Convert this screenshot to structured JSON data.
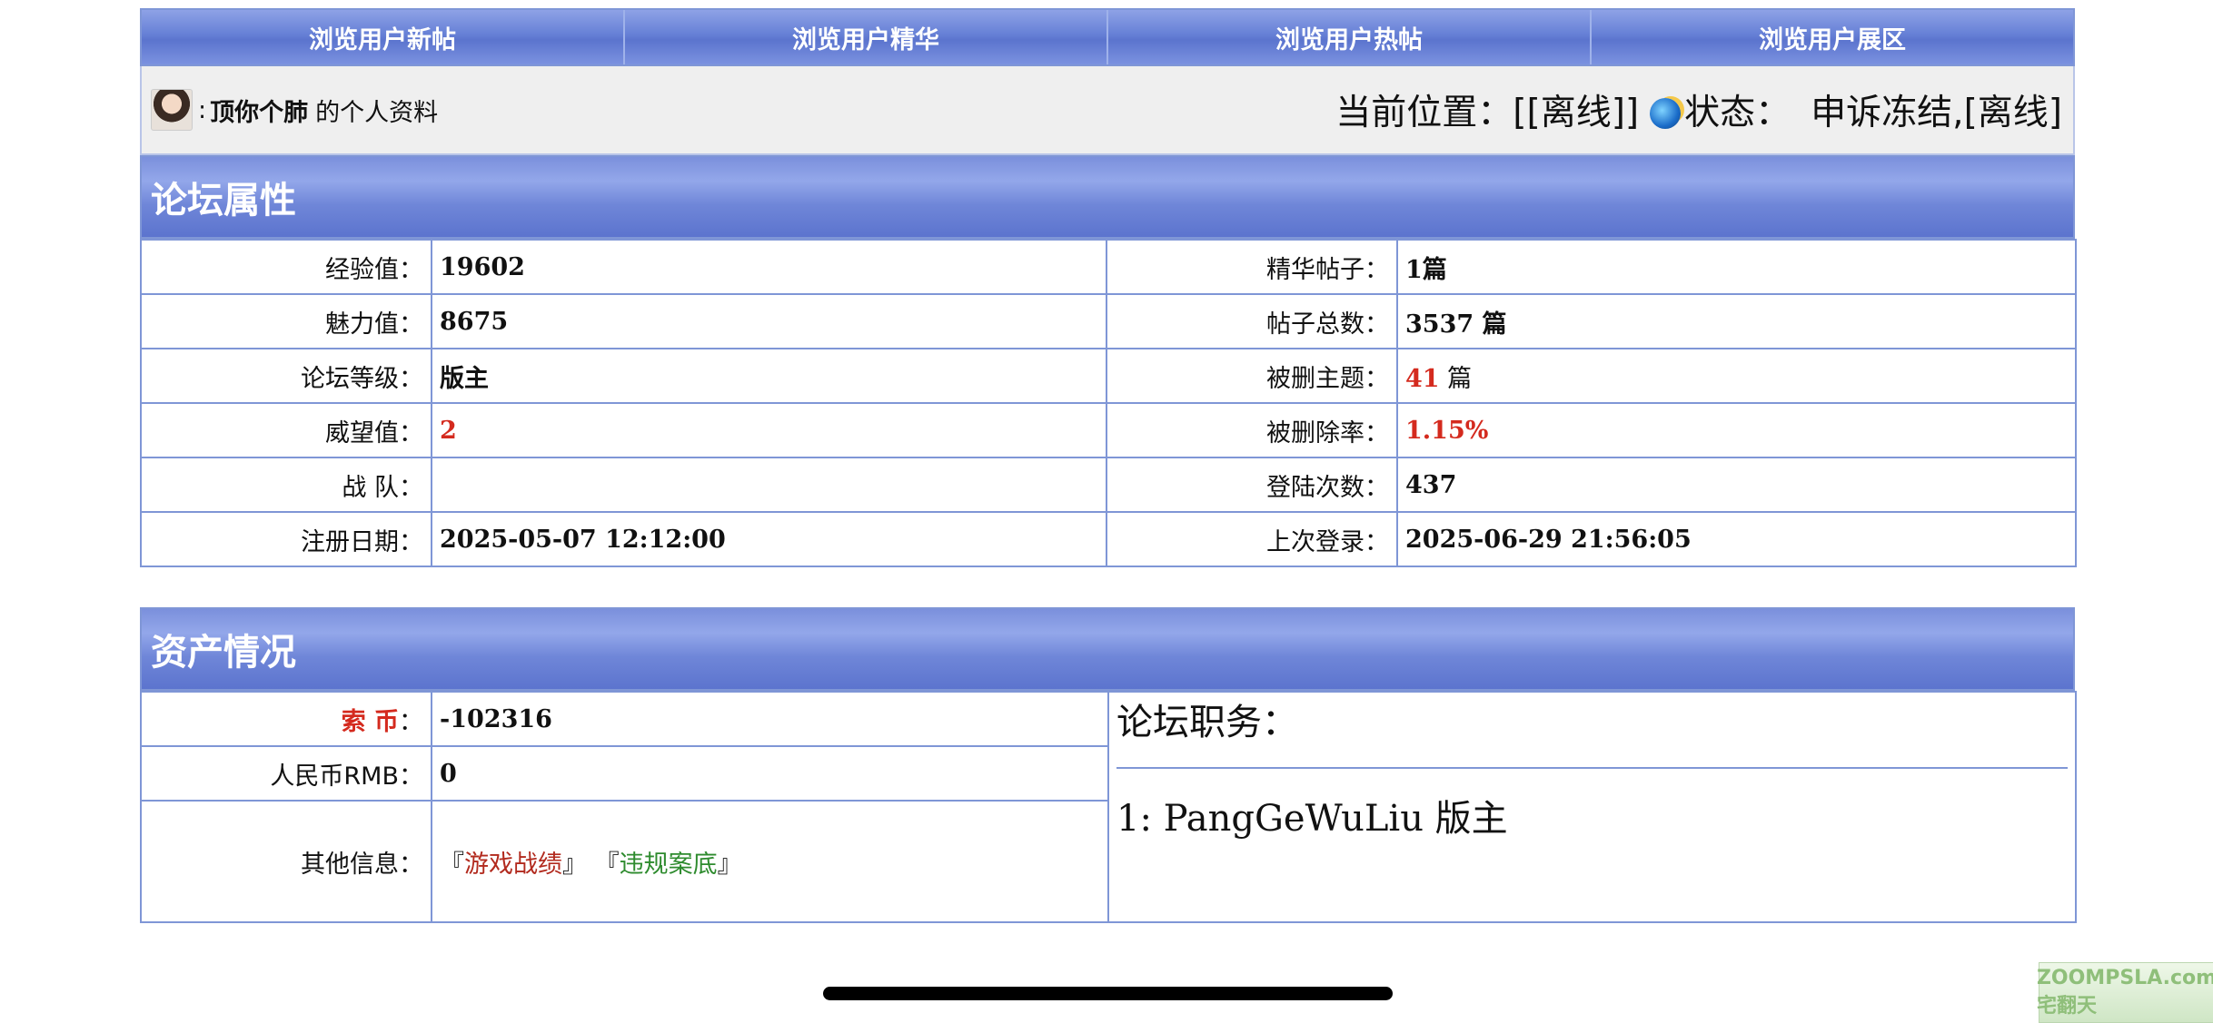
{
  "nav": [
    "浏览用户新帖",
    "浏览用户精华",
    "浏览用户热帖",
    "浏览用户展区"
  ],
  "profile": {
    "username": "顶你个肺",
    "suffix": "的个人资料",
    "colon": ":",
    "location_label": "当前位置：",
    "location_value": "[[离线]]",
    "status_label": "状态：",
    "status_value": "申诉冻结,[离线]"
  },
  "forum": {
    "title": "论坛属性",
    "rows": [
      {
        "l1": "经验值：",
        "v1": "19602",
        "l2": "精华帖子：",
        "v2": "1篇"
      },
      {
        "l1": "魅力值：",
        "v1": "8675",
        "l2": "帖子总数：",
        "v2": "3537 篇"
      },
      {
        "l1": "论坛等级：",
        "v1": "版主",
        "l2": "被删主题：",
        "v2_num": "41",
        "v2_unit": " 篇"
      },
      {
        "l1": "威望值：",
        "v1": "2",
        "l2": "被删除率：",
        "v2": "1.15%"
      },
      {
        "l1": "战 队：",
        "v1": "",
        "l2": "登陆次数：",
        "v2": "437"
      },
      {
        "l1": "注册日期：",
        "v1": "2025-05-07 12:12:00",
        "l2": "上次登录：",
        "v2": "2025-06-29 21:56:05"
      }
    ]
  },
  "assets": {
    "title": "资产情况",
    "coin_label": "索 币",
    "coin_colon": "：",
    "coin_value": "-102316",
    "rmb_label": "人民币RMB：",
    "rmb_value": "0",
    "other_label": "其他信息：",
    "links": [
      {
        "open": "『",
        "text": "游戏战绩",
        "close": "』"
      },
      {
        "open": "『",
        "text": "违规案底",
        "close": "』"
      }
    ],
    "duty_title": "论坛职务：",
    "duty_item": "1: PangGeWuLiu 版主"
  },
  "colors": {
    "accent": "#6680d6",
    "red": "#d42a1e",
    "green": "#2e8b2e"
  },
  "watermark": "ZOOMPSLA.com 宅翻天"
}
